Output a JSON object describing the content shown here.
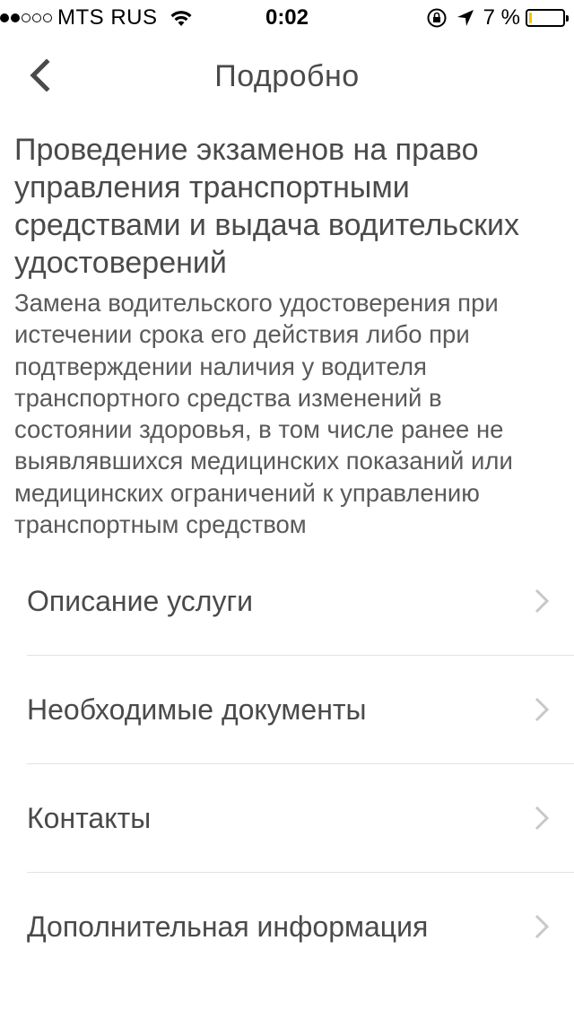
{
  "status_bar": {
    "carrier": "MTS RUS",
    "time": "0:02",
    "battery_percent": "7 %",
    "signal_bars_filled": 2,
    "signal_bars_total": 5,
    "battery_level": 0.07,
    "battery_color": "#f5c400"
  },
  "nav": {
    "title": "Подробно",
    "back_icon": "chevron-left-icon"
  },
  "service": {
    "title": "Проведение экзаменов на право управления транспортными средствами и выдача водительских удостоверений",
    "subtitle": "Замена водительского удостоверения при истечении срока его действия либо при подтверждении наличия у водителя транспортного средства изменений в состоянии здоровья, в том числе ранее не выявлявшихся медицинских показаний или медицинских ограничений к управлению транспортным средством"
  },
  "menu": {
    "items": [
      {
        "label": "Описание услуги",
        "icon": "chevron-right-icon"
      },
      {
        "label": "Необходимые документы",
        "icon": "chevron-right-icon"
      },
      {
        "label": "Контакты",
        "icon": "chevron-right-icon"
      },
      {
        "label": "Дополнительная информация",
        "icon": "chevron-right-icon"
      }
    ]
  }
}
